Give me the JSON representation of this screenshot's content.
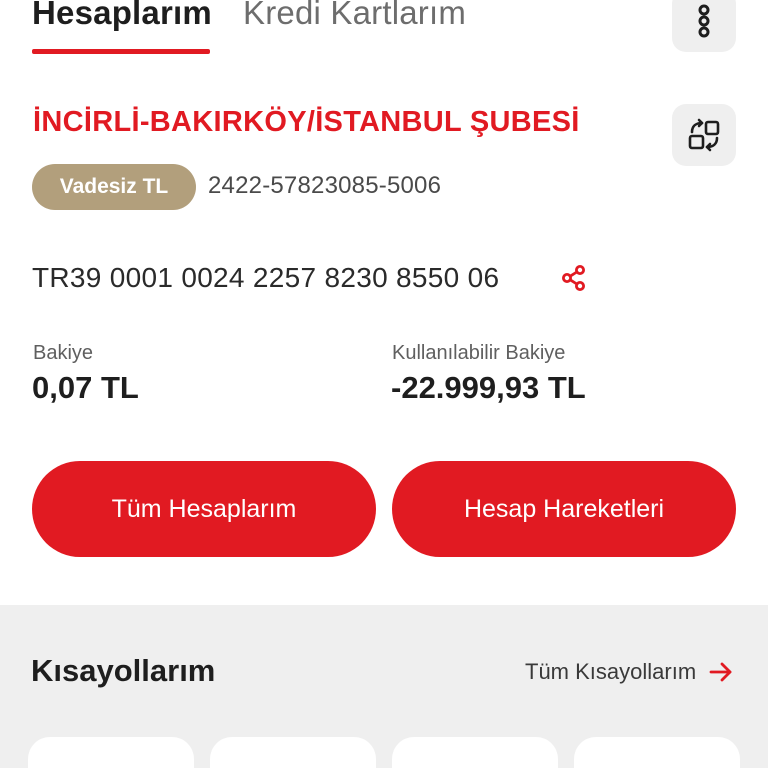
{
  "tabs": {
    "active": "Hesaplarım",
    "inactive": "Kredi Kartlarım"
  },
  "account": {
    "branch": "İNCİRLİ-BAKIRKÖY/İSTANBUL ŞUBESİ",
    "type_badge": "Vadesiz TL",
    "number": "2422-57823085-5006",
    "iban": "TR39 0001 0024 2257 8230 8550 06"
  },
  "balance": {
    "label": "Bakiye",
    "value": "0,07 TL",
    "available_label": "Kullanılabilir Bakiye",
    "available_value": "-22.999,93 TL"
  },
  "actions": {
    "all_accounts": "Tüm Hesaplarım",
    "transactions": "Hesap Hareketleri"
  },
  "shortcuts": {
    "title": "Kısayollarım",
    "all_link": "Tüm Kısayollarım"
  },
  "icons": [
    "more-vertical-icon",
    "switch-account-icon",
    "share-icon",
    "arrow-right-icon"
  ],
  "colors": {
    "brand_red": "#e11a22",
    "badge_gold": "#b29f7c",
    "panel_gray": "#efefef"
  }
}
